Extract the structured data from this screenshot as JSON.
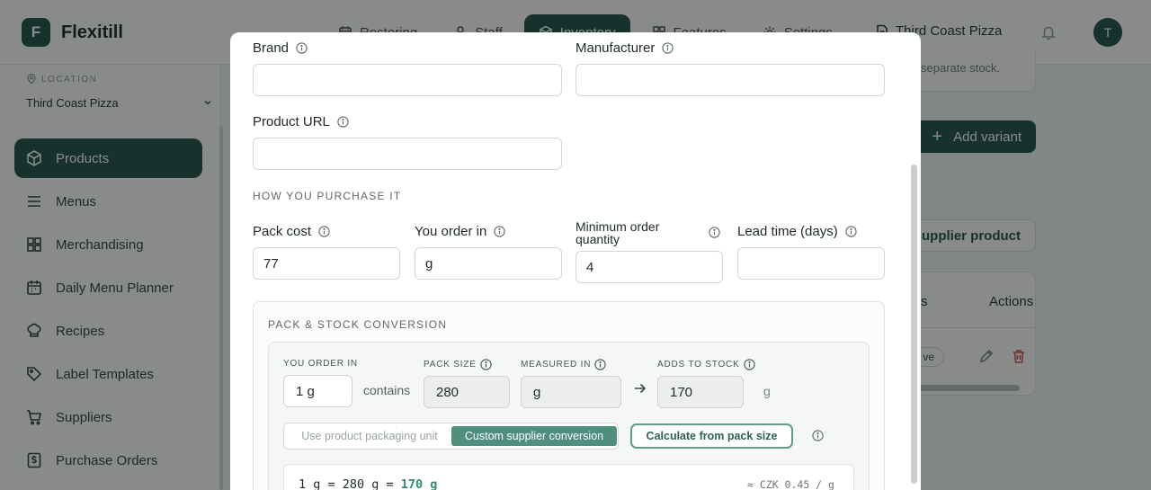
{
  "app": {
    "logo_letter": "F",
    "name": "Flexitill",
    "nav": [
      {
        "label": "Rostering"
      },
      {
        "label": "Staff"
      },
      {
        "label": "Inventory"
      },
      {
        "label": "Features"
      },
      {
        "label": "Settings"
      }
    ],
    "store": "Third Coast Pizza",
    "avatar_initial": "T"
  },
  "sidebar": {
    "location_label": "LOCATION",
    "location_value": "Third Coast Pizza",
    "items": [
      {
        "label": "Products",
        "icon": "box-icon"
      },
      {
        "label": "Menus",
        "icon": "list-icon"
      },
      {
        "label": "Merchandising",
        "icon": "grid-icon"
      },
      {
        "label": "Daily Menu Planner",
        "icon": "calendar-icon"
      },
      {
        "label": "Recipes",
        "icon": "chef-hat-icon"
      },
      {
        "label": "Label Templates",
        "icon": "tag-icon"
      },
      {
        "label": "Suppliers",
        "icon": "cart-icon"
      },
      {
        "label": "Purchase Orders",
        "icon": "dollar-doc-icon"
      }
    ]
  },
  "background_panel": {
    "hint": "separate stock.",
    "add_variant": "Add variant",
    "supplier_button": "supplier product",
    "col_s": "s",
    "col_actions": "Actions",
    "status": "ve"
  },
  "modal": {
    "brand_label": "Brand",
    "brand_value": "",
    "manufacturer_label": "Manufacturer",
    "manufacturer_value": "",
    "product_url_label": "Product URL",
    "product_url_value": "",
    "purchase_heading": "HOW YOU PURCHASE IT",
    "pack_cost_label": "Pack cost",
    "pack_cost_value": "77",
    "order_in_label": "You order in",
    "order_in_value": "g",
    "min_qty_label_1": "Minimum order",
    "min_qty_label_2": "quantity",
    "min_qty_value": "4",
    "lead_time_label": "Lead time (days)",
    "lead_time_value": "",
    "conversion": {
      "heading": "PACK & STOCK CONVERSION",
      "you_order_in_label": "YOU ORDER IN",
      "you_order_in_value": "1 g",
      "contains": "contains",
      "pack_size_label": "PACK SIZE",
      "pack_size_value": "280",
      "measured_in_label": "MEASURED IN",
      "measured_in_value": "g",
      "adds_to_stock_label": "ADDS TO STOCK",
      "adds_to_stock_value": "170",
      "adds_unit": "g",
      "option_packaging": "Use product packaging unit",
      "option_custom": "Custom supplier conversion",
      "calculate_button": "Calculate from pack size",
      "formula_prefix": "1 g = 280 g = ",
      "formula_result": "170 g",
      "approx": "≈ CZK 0.45 / g"
    }
  }
}
